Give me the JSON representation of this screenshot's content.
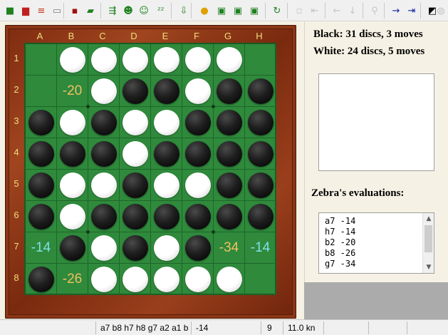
{
  "toolbar": {
    "buttons": [
      {
        "name": "new-game-button",
        "icon": "new-game-icon",
        "glyph": "■",
        "color": "#208020",
        "disabled": false
      },
      {
        "name": "open-game-button",
        "icon": "open-book-icon",
        "glyph": "▆",
        "color": "#c02020",
        "disabled": false
      },
      {
        "name": "stack-button",
        "icon": "stack-icon",
        "glyph": "≡",
        "color": "#c04020",
        "disabled": false
      },
      {
        "name": "clipboard-button",
        "icon": "clipboard-icon",
        "glyph": "▭",
        "color": "#808080",
        "disabled": false
      },
      {
        "name": "save-button",
        "icon": "floppy-disk-icon",
        "glyph": "▪",
        "color": "#a01010",
        "disabled": false
      },
      {
        "name": "open-folder-button",
        "icon": "folder-icon",
        "glyph": "▰",
        "color": "#208020",
        "disabled": false
      },
      {
        "name": "engine-move-button",
        "icon": "board-arrow-icon",
        "glyph": "⇶",
        "color": "#208020",
        "disabled": false
      },
      {
        "name": "analyze-button",
        "icon": "person-icon",
        "glyph": "☻",
        "color": "#208020",
        "disabled": false
      },
      {
        "name": "human-vs-button",
        "icon": "person-outline-icon",
        "glyph": "☺",
        "color": "#208020",
        "disabled": false
      },
      {
        "name": "sleep-button",
        "icon": "zzz-icon",
        "glyph": "ᶻᶻ",
        "color": "#208020",
        "disabled": false
      },
      {
        "name": "download-board-button",
        "icon": "download-icon",
        "glyph": "⇩",
        "color": "#208020",
        "disabled": false
      },
      {
        "name": "stop-button",
        "icon": "stop-icon",
        "glyph": "●",
        "color": "#e0a000",
        "disabled": false
      },
      {
        "name": "board-green-1-button",
        "icon": "board-icon",
        "glyph": "▣",
        "color": "#208020",
        "disabled": false
      },
      {
        "name": "board-green-2-button",
        "icon": "board-icon",
        "glyph": "▣",
        "color": "#208020",
        "disabled": false
      },
      {
        "name": "board-green-3-button",
        "icon": "board-icon",
        "glyph": "▣",
        "color": "#208020",
        "disabled": false
      },
      {
        "name": "refresh-button",
        "icon": "refresh-icon",
        "glyph": "↻",
        "color": "#208020",
        "disabled": false
      },
      {
        "name": "blank-button",
        "icon": "blank-icon",
        "glyph": "▫",
        "color": "#909090",
        "disabled": true
      },
      {
        "name": "first-move-button",
        "icon": "first-icon",
        "glyph": "⇤",
        "color": "#909090",
        "disabled": true
      },
      {
        "name": "back-button",
        "icon": "back-arrow-icon",
        "glyph": "←",
        "color": "#909090",
        "disabled": true
      },
      {
        "name": "down-button",
        "icon": "down-arrow-icon",
        "glyph": "↓",
        "color": "#909090",
        "disabled": true
      },
      {
        "name": "hint-button",
        "icon": "hint-icon",
        "glyph": "⚲",
        "color": "#909090",
        "disabled": true
      },
      {
        "name": "forward-button",
        "icon": "forward-arrow-icon",
        "glyph": "→",
        "color": "#1020a0",
        "disabled": false
      },
      {
        "name": "last-move-button",
        "icon": "last-icon",
        "glyph": "⇥",
        "color": "#1020a0",
        "disabled": false
      },
      {
        "name": "flip-board-button",
        "icon": "contrast-icon",
        "glyph": "◩",
        "color": "#000000",
        "disabled": false
      },
      {
        "name": "options-button",
        "icon": "options-icon",
        "glyph": "◍",
        "color": "#909090",
        "disabled": true
      }
    ]
  },
  "board": {
    "columns": [
      "A",
      "B",
      "C",
      "D",
      "E",
      "F",
      "G",
      "H"
    ],
    "rows": [
      "1",
      "2",
      "3",
      "4",
      "5",
      "6",
      "7",
      "8"
    ],
    "cells": [
      [
        "",
        "W",
        "W",
        "W",
        "W",
        "W",
        "W",
        ""
      ],
      [
        "",
        "",
        "W",
        "B",
        "B",
        "W",
        "B",
        "B"
      ],
      [
        "B",
        "W",
        "B",
        "W",
        "W",
        "B",
        "B",
        "B"
      ],
      [
        "B",
        "B",
        "B",
        "W",
        "B",
        "B",
        "B",
        "B"
      ],
      [
        "B",
        "W",
        "W",
        "B",
        "W",
        "W",
        "B",
        "B"
      ],
      [
        "B",
        "W",
        "B",
        "B",
        "B",
        "B",
        "B",
        "B"
      ],
      [
        "",
        "B",
        "W",
        "B",
        "W",
        "B",
        "",
        ""
      ],
      [
        "B",
        "",
        "W",
        "W",
        "W",
        "W",
        "W",
        ""
      ]
    ],
    "evals": [
      {
        "row": 1,
        "col": 1,
        "text": "-20",
        "color": "#f2c060"
      },
      {
        "row": 6,
        "col": 0,
        "text": "-14",
        "color": "#7fe0e6"
      },
      {
        "row": 6,
        "col": 6,
        "text": "-34",
        "color": "#f2c060"
      },
      {
        "row": 6,
        "col": 7,
        "text": "-14",
        "color": "#7fe0e6"
      },
      {
        "row": 7,
        "col": 1,
        "text": "-26",
        "color": "#f2c060"
      }
    ]
  },
  "score": {
    "black": "Black:  31 discs, 3 moves",
    "white": "White:  24 discs, 5 moves"
  },
  "evaluations": {
    "title": "Zebra's evaluations:",
    "items": [
      "a7 -14",
      "h7 -14",
      "b2 -20",
      "b8 -26",
      "g7 -34"
    ]
  },
  "status": {
    "moves": "a7 b8 h7 h8 g7 a2 a1 b2",
    "score": "-14",
    "depth": "9",
    "speed": "11.0 kn"
  }
}
